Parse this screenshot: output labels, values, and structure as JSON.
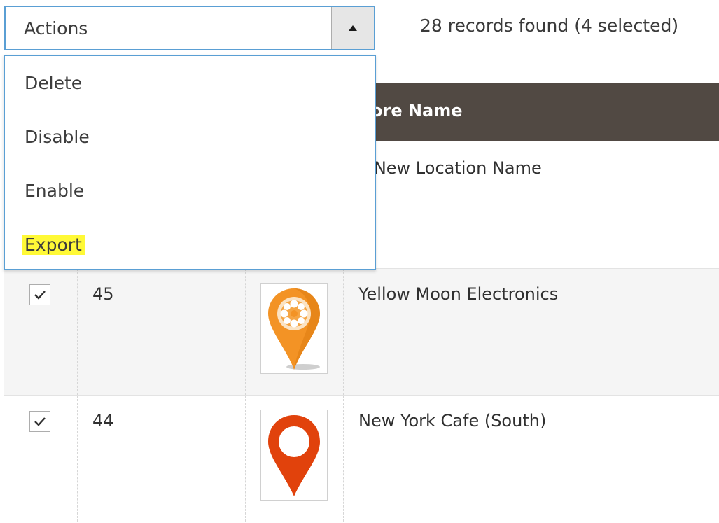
{
  "toolbar": {
    "actions_label": "Actions",
    "records_text": "28 records found (4 selected)"
  },
  "actions_menu": {
    "items": [
      {
        "label": "Delete"
      },
      {
        "label": "Disable"
      },
      {
        "label": "Enable"
      },
      {
        "label": "Export",
        "highlighted": true
      }
    ]
  },
  "grid": {
    "header": {
      "store_name": "ore Name"
    },
    "rows": [
      {
        "id": "",
        "name": "y New Location Name",
        "checked": false
      },
      {
        "id": "45",
        "name": "Yellow Moon Electronics",
        "checked": true,
        "icon": "orange-flower-pin-icon"
      },
      {
        "id": "44",
        "name": "New York Cafe (South)",
        "checked": true,
        "icon": "red-ring-pin-icon"
      }
    ]
  },
  "colors": {
    "focus_border": "#5a9fd4",
    "header_bg": "#514943",
    "highlight": "#fff936",
    "orange_pin": "#f39325",
    "red_pin": "#e1420c"
  }
}
